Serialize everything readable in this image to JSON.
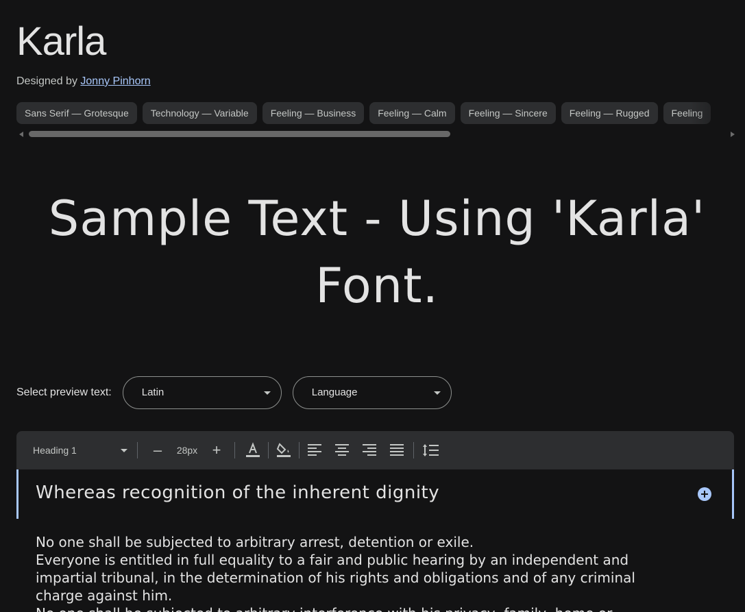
{
  "font": {
    "name": "Karla",
    "designed_by_label": "Designed by",
    "designer": "Jonny Pinhorn"
  },
  "tags": [
    "Sans Serif — Grotesque",
    "Technology — Variable",
    "Feeling — Business",
    "Feeling — Calm",
    "Feeling — Sincere",
    "Feeling — Rugged",
    "Feeling"
  ],
  "sample_text": "Sample Text - Using 'Karla' Font.",
  "preview": {
    "label": "Select preview text:",
    "script_select": "Latin",
    "language_select": "Language"
  },
  "toolbar": {
    "style_select": "Heading 1",
    "decrease_label": "–",
    "font_size": "28px",
    "increase_label": "+"
  },
  "editor": {
    "heading": "Whereas recognition of the inherent dignity",
    "paragraphs": [
      "No one shall be subjected to arbitrary arrest, detention or exile.",
      "Everyone is entitled in full equality to a fair and public hearing by an independent and impartial tribunal, in the determination of his rights and obligations and of any criminal charge against him.",
      "No one shall be subjected to arbitrary interference with his privacy, family, home or"
    ]
  },
  "colors": {
    "background": "#131314",
    "accent": "#a8c7fa",
    "chip": "#2d2e30"
  }
}
